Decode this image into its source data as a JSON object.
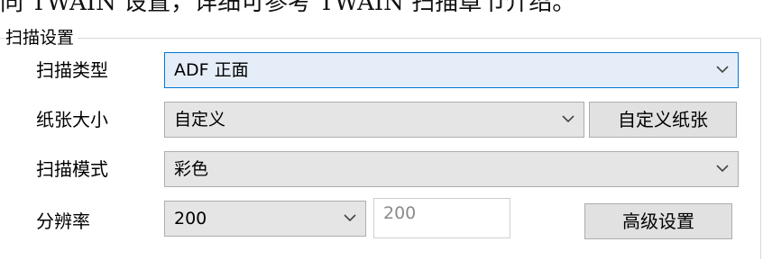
{
  "caption": "同 TWAIN 设置，详细可参考 TWAIN 扫描章节介绍。",
  "scan_settings": {
    "group_title": "扫描设置",
    "scan_type": {
      "label": "扫描类型",
      "value": "ADF 正面"
    },
    "paper_size": {
      "label": "纸张大小",
      "value": "自定义",
      "button_label": "自定义纸张"
    },
    "scan_mode": {
      "label": "扫描模式",
      "value": "彩色"
    },
    "resolution": {
      "label": "分辨率",
      "value": "200",
      "custom_value": "200"
    },
    "advanced_button_label": "高级设置"
  },
  "colors": {
    "focus_border": "#0078d7",
    "combo_background": "#e5e5e5",
    "button_background": "#e1e1e1"
  },
  "icons": {
    "dropdown": "chevron-down-icon"
  }
}
